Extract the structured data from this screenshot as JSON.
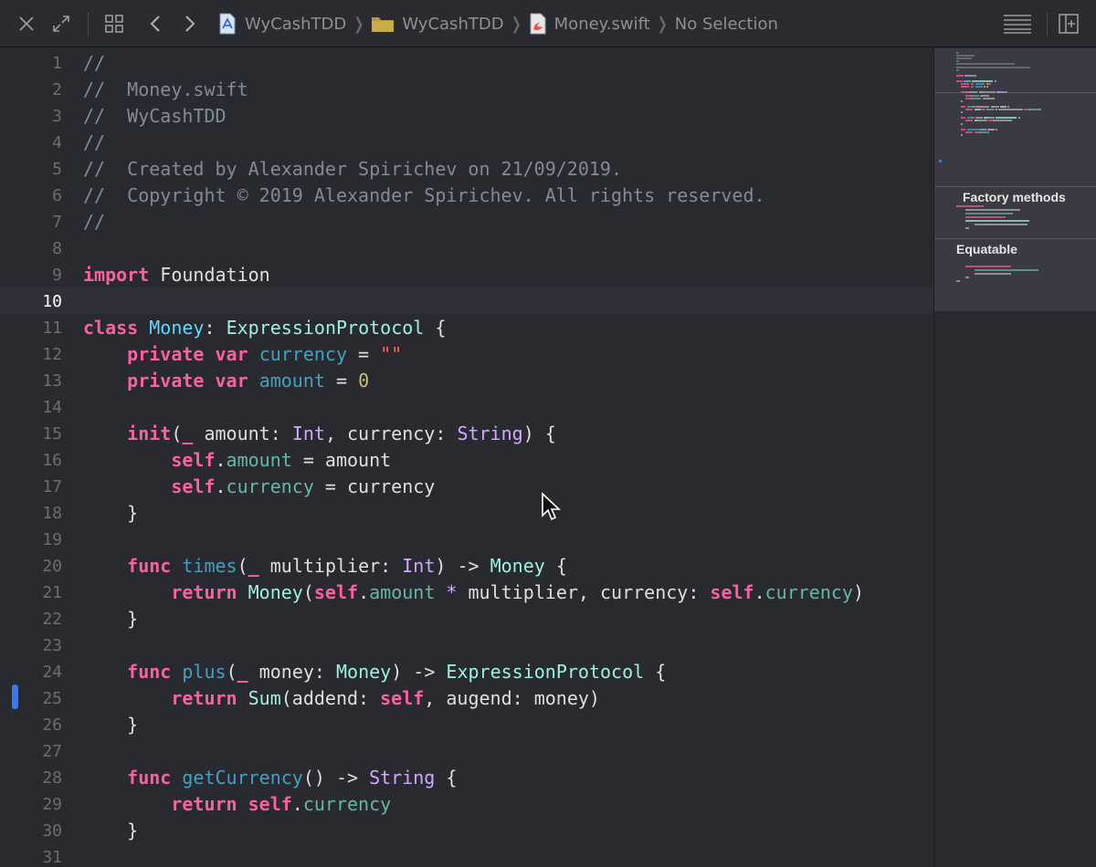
{
  "toolbar": {
    "buttons": [
      "close-icon",
      "expand-icon",
      "related-items-icon",
      "back-icon",
      "forward-icon",
      "editor-options-icon",
      "add-editor-icon"
    ],
    "breadcrumbs": [
      {
        "label": "WyCashTDD",
        "icon": "xcode-project-icon"
      },
      {
        "label": "WyCashTDD",
        "icon": "folder-icon"
      },
      {
        "label": "Money.swift",
        "icon": "swift-file-icon"
      },
      {
        "label": "No Selection",
        "icon": ""
      }
    ]
  },
  "editor": {
    "current_line": 10,
    "marker_line": 25,
    "lines": [
      {
        "n": "1",
        "tokens": [
          [
            "cm",
            "//"
          ]
        ]
      },
      {
        "n": "2",
        "tokens": [
          [
            "cm",
            "//  Money.swift"
          ]
        ]
      },
      {
        "n": "3",
        "tokens": [
          [
            "cm",
            "//  WyCashTDD"
          ]
        ]
      },
      {
        "n": "4",
        "tokens": [
          [
            "cm",
            "//"
          ]
        ]
      },
      {
        "n": "5",
        "tokens": [
          [
            "cm",
            "//  Created by Alexander Spirichev on 21/09/2019."
          ]
        ]
      },
      {
        "n": "6",
        "tokens": [
          [
            "cm",
            "//  Copyright © 2019 Alexander Spirichev. All rights reserved."
          ]
        ]
      },
      {
        "n": "7",
        "tokens": [
          [
            "cm",
            "//"
          ]
        ]
      },
      {
        "n": "8",
        "tokens": []
      },
      {
        "n": "9",
        "tokens": [
          [
            "kw",
            "import"
          ],
          [
            "pl",
            " Foundation"
          ]
        ]
      },
      {
        "n": "10",
        "tokens": []
      },
      {
        "n": "11",
        "tokens": [
          [
            "kw",
            "class"
          ],
          [
            "pl",
            " "
          ],
          [
            "ty",
            "Money"
          ],
          [
            "pl",
            ": "
          ],
          [
            "pt",
            "ExpressionProtocol"
          ],
          [
            "pl",
            " {"
          ]
        ]
      },
      {
        "n": "12",
        "tokens": [
          [
            "pl",
            "    "
          ],
          [
            "kw",
            "private"
          ],
          [
            "pl",
            " "
          ],
          [
            "kw",
            "var"
          ],
          [
            "pl",
            " "
          ],
          [
            "va",
            "currency"
          ],
          [
            "pl",
            " = "
          ],
          [
            "st",
            "\"\""
          ]
        ]
      },
      {
        "n": "13",
        "tokens": [
          [
            "pl",
            "    "
          ],
          [
            "kw",
            "private"
          ],
          [
            "pl",
            " "
          ],
          [
            "kw",
            "var"
          ],
          [
            "pl",
            " "
          ],
          [
            "va",
            "amount"
          ],
          [
            "pl",
            " = "
          ],
          [
            "nu",
            "0"
          ]
        ]
      },
      {
        "n": "14",
        "tokens": []
      },
      {
        "n": "15",
        "tokens": [
          [
            "pl",
            "    "
          ],
          [
            "kw",
            "init"
          ],
          [
            "pl",
            "("
          ],
          [
            "kw",
            "_"
          ],
          [
            "pl",
            " amount: "
          ],
          [
            "ot",
            "Int"
          ],
          [
            "pl",
            ", currency: "
          ],
          [
            "ot",
            "String"
          ],
          [
            "pl",
            ") {"
          ]
        ]
      },
      {
        "n": "16",
        "tokens": [
          [
            "pl",
            "        "
          ],
          [
            "kw",
            "self"
          ],
          [
            "pl",
            "."
          ],
          [
            "fn",
            "amount"
          ],
          [
            "pl",
            " = amount"
          ]
        ]
      },
      {
        "n": "17",
        "tokens": [
          [
            "pl",
            "        "
          ],
          [
            "kw",
            "self"
          ],
          [
            "pl",
            "."
          ],
          [
            "fn",
            "currency"
          ],
          [
            "pl",
            " = currency"
          ]
        ]
      },
      {
        "n": "18",
        "tokens": [
          [
            "pl",
            "    }"
          ]
        ]
      },
      {
        "n": "19",
        "tokens": []
      },
      {
        "n": "20",
        "tokens": [
          [
            "pl",
            "    "
          ],
          [
            "kw",
            "func"
          ],
          [
            "pl",
            " "
          ],
          [
            "va",
            "times"
          ],
          [
            "pl",
            "("
          ],
          [
            "kw",
            "_"
          ],
          [
            "pl",
            " multiplier: "
          ],
          [
            "ot",
            "Int"
          ],
          [
            "pl",
            ") -> "
          ],
          [
            "pt",
            "Money"
          ],
          [
            "pl",
            " {"
          ]
        ]
      },
      {
        "n": "21",
        "tokens": [
          [
            "pl",
            "        "
          ],
          [
            "kw",
            "return"
          ],
          [
            "pl",
            " "
          ],
          [
            "pt",
            "Money"
          ],
          [
            "pl",
            "("
          ],
          [
            "kw",
            "self"
          ],
          [
            "pl",
            "."
          ],
          [
            "fn",
            "amount"
          ],
          [
            "pl",
            " "
          ],
          [
            "ot",
            "*"
          ],
          [
            "pl",
            " multiplier, currency: "
          ],
          [
            "kw",
            "self"
          ],
          [
            "pl",
            "."
          ],
          [
            "fn",
            "currency"
          ],
          [
            "pl",
            ")"
          ]
        ]
      },
      {
        "n": "22",
        "tokens": [
          [
            "pl",
            "    }"
          ]
        ]
      },
      {
        "n": "23",
        "tokens": []
      },
      {
        "n": "24",
        "tokens": [
          [
            "pl",
            "    "
          ],
          [
            "kw",
            "func"
          ],
          [
            "pl",
            " "
          ],
          [
            "va",
            "plus"
          ],
          [
            "pl",
            "("
          ],
          [
            "kw",
            "_"
          ],
          [
            "pl",
            " money: "
          ],
          [
            "pt",
            "Money"
          ],
          [
            "pl",
            ") -> "
          ],
          [
            "pt",
            "ExpressionProtocol"
          ],
          [
            "pl",
            " {"
          ]
        ]
      },
      {
        "n": "25",
        "tokens": [
          [
            "pl",
            "        "
          ],
          [
            "kw",
            "return"
          ],
          [
            "pl",
            " "
          ],
          [
            "pt",
            "Sum"
          ],
          [
            "pl",
            "(addend: "
          ],
          [
            "kw",
            "self"
          ],
          [
            "pl",
            ", augend: money)"
          ]
        ]
      },
      {
        "n": "26",
        "tokens": [
          [
            "pl",
            "    }"
          ]
        ]
      },
      {
        "n": "27",
        "tokens": []
      },
      {
        "n": "28",
        "tokens": [
          [
            "pl",
            "    "
          ],
          [
            "kw",
            "func"
          ],
          [
            "pl",
            " "
          ],
          [
            "va",
            "getCurrency"
          ],
          [
            "pl",
            "() -> "
          ],
          [
            "ot",
            "String"
          ],
          [
            "pl",
            " {"
          ]
        ]
      },
      {
        "n": "29",
        "tokens": [
          [
            "pl",
            "        "
          ],
          [
            "kw",
            "return"
          ],
          [
            "pl",
            " "
          ],
          [
            "kw",
            "self"
          ],
          [
            "pl",
            "."
          ],
          [
            "fn",
            "currency"
          ]
        ]
      },
      {
        "n": "30",
        "tokens": [
          [
            "pl",
            "    }"
          ]
        ]
      },
      {
        "n": "31",
        "tokens": []
      }
    ]
  },
  "minimap": {
    "sections": [
      "Factory methods",
      "Equatable"
    ]
  },
  "colors": {
    "background": "#292a30",
    "comment": "#7f8c98",
    "keyword": "#fc5fa3",
    "type_decl": "#5dd8ff",
    "project_type": "#9ef1dd",
    "other_type": "#d0a8ff",
    "function_decl": "#41a1c0",
    "property": "#67b7a4",
    "string": "#fc6a5d",
    "number": "#d0bf69",
    "marker": "#3478f6"
  }
}
